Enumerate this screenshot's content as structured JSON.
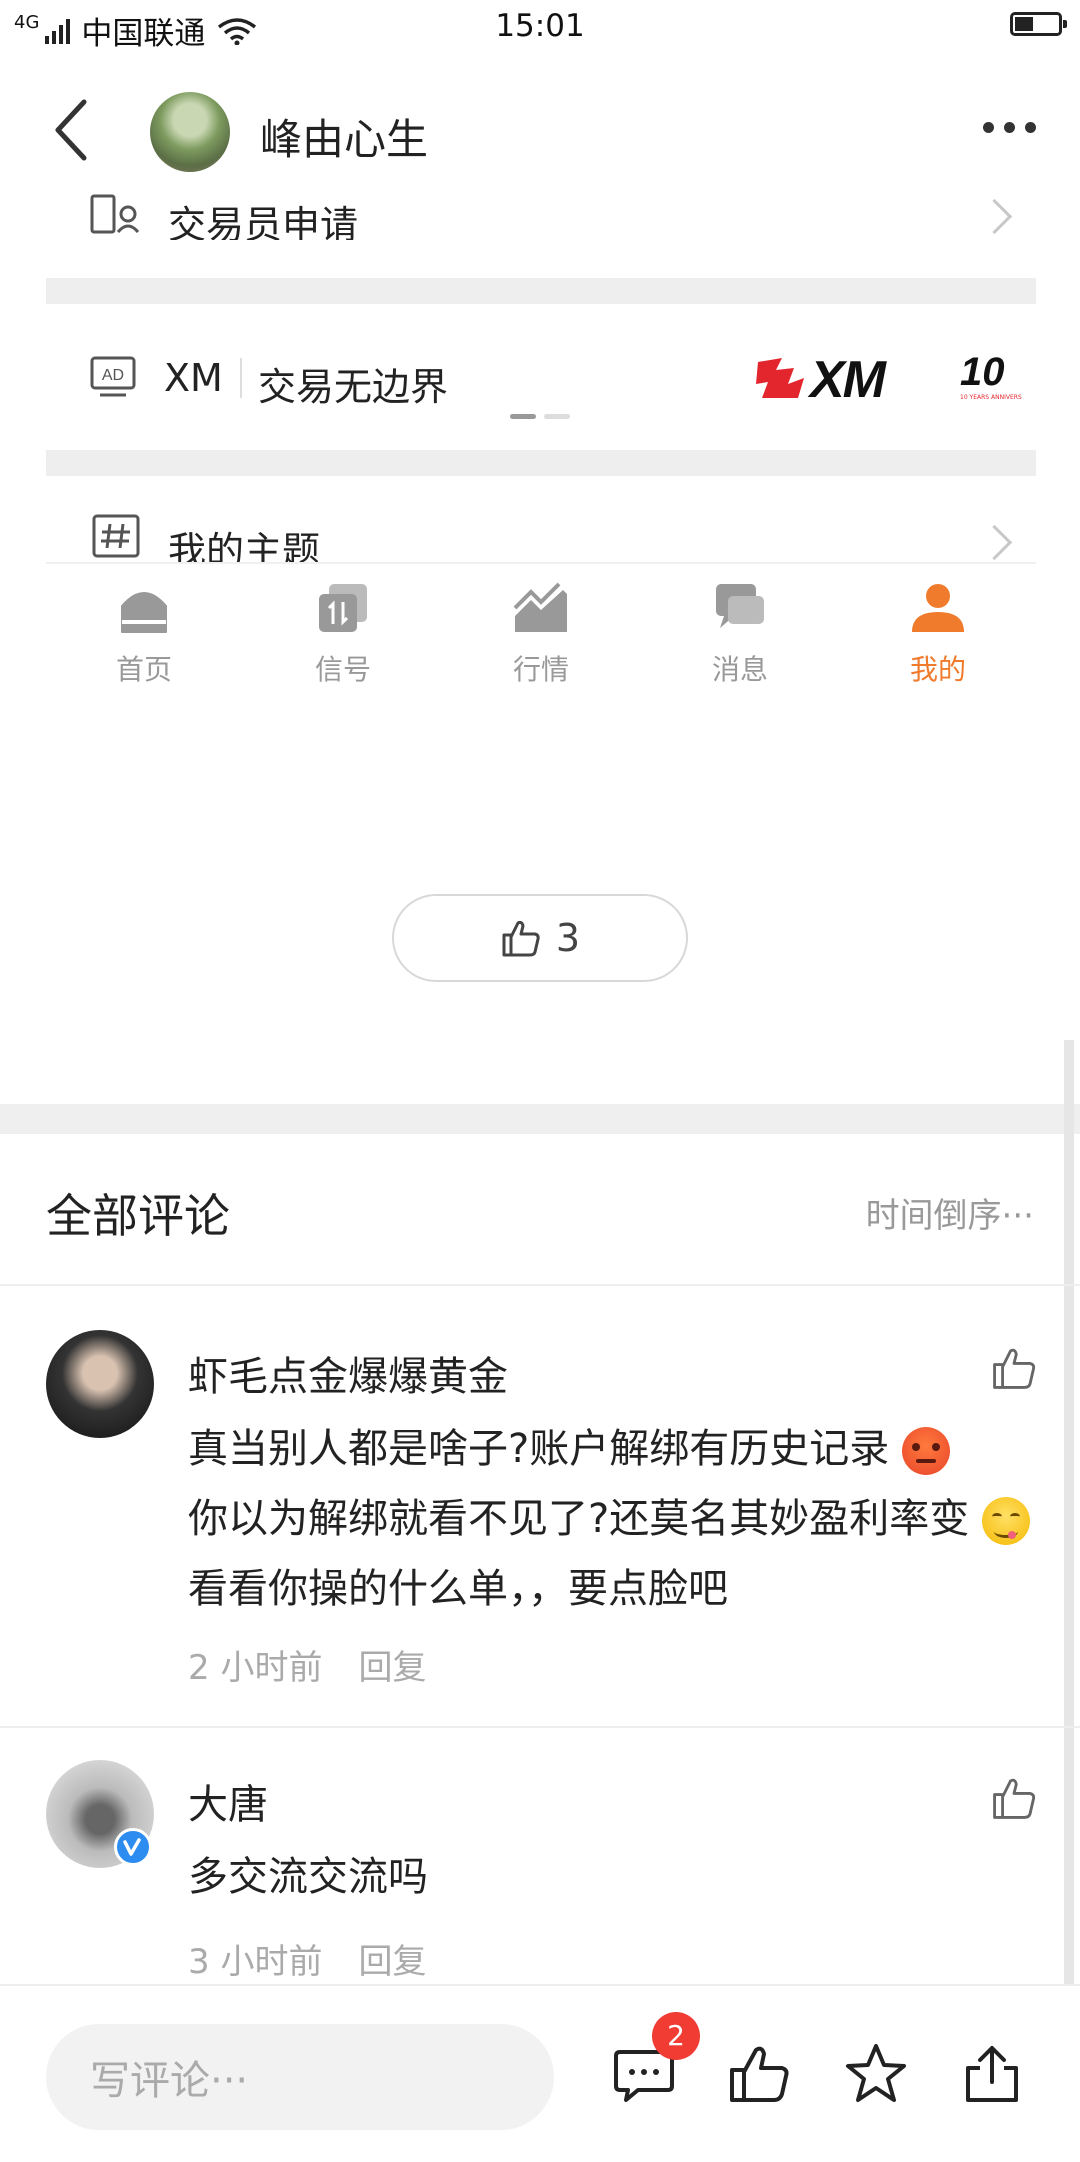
{
  "status_bar": {
    "network": "4G",
    "carrier": "中国联通",
    "time": "15:01"
  },
  "header": {
    "username": "峰由心生"
  },
  "embedded": {
    "trader_apply": "交易员申请",
    "ad_brand": "XM",
    "ad_slogan": "交易无边界",
    "ad_logo_text": "XM",
    "ad_anniv_text": "10 YEARS ANNIVERSARY",
    "my_topics": "我的主题",
    "tabs": [
      {
        "label": "首页",
        "icon": "home-icon"
      },
      {
        "label": "信号",
        "icon": "signal-icon"
      },
      {
        "label": "行情",
        "icon": "market-icon"
      },
      {
        "label": "消息",
        "icon": "message-icon"
      },
      {
        "label": "我的",
        "icon": "profile-icon",
        "active": true
      }
    ],
    "active_color": "#f07b2c"
  },
  "post": {
    "like_count": "3"
  },
  "comments_section": {
    "title": "全部评论",
    "sort_label": "时间倒序···",
    "comments": [
      {
        "name": "虾毛点金爆爆黄金",
        "text_parts": [
          "真当别人都是啥子?账户解绑有历史记录",
          "你以为解绑就看不见了?还莫名其妙盈利率变",
          "看看你操的什么单，，要点脸吧"
        ],
        "time": "2 小时前",
        "reply": "回复"
      },
      {
        "name": "大唐",
        "text": "多交流交流吗",
        "time": "3 小时前",
        "reply": "回复",
        "verified": true
      }
    ]
  },
  "bottom_bar": {
    "input_placeholder": "写评论···",
    "comment_badge": "2"
  }
}
